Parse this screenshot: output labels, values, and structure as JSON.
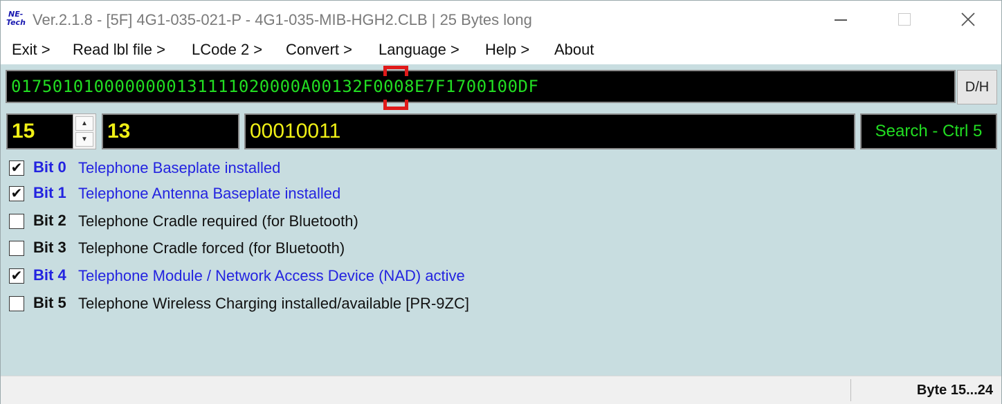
{
  "titlebar": {
    "logo_line1": "NE-",
    "logo_line2": "Tech",
    "title": "Ver.2.1.8 - [5F] 4G1-035-021-P - 4G1-035-MIB-HGH2.CLB | 25 Bytes long",
    "minimize_glyph": "—",
    "maximize_glyph": "☐",
    "close_glyph": "✕"
  },
  "menu": {
    "items": [
      "Exit >",
      "Read lbl file >",
      "LCode 2 >",
      "Convert >",
      "Language >",
      "Help >",
      "About"
    ]
  },
  "hex": {
    "value": "0175010100000000131111020000A00132F0008E7F1700100DF",
    "toggle_label": "D/H"
  },
  "fields": {
    "byte_index": "15",
    "decimal_value": "13",
    "binary_value": "00010011",
    "search_label": "Search - Ctrl 5",
    "spin_up": "▲",
    "spin_down": "▼"
  },
  "bits": [
    {
      "label": "Bit 0",
      "description": "Telephone Baseplate installed",
      "checked": true
    },
    {
      "label": "Bit 1",
      "description": "Telephone Antenna Baseplate installed",
      "checked": true
    },
    {
      "label": "Bit 2",
      "description": "Telephone Cradle required (for Bluetooth)",
      "checked": false
    },
    {
      "label": "Bit 3",
      "description": "Telephone Cradle forced (for Bluetooth)",
      "checked": false
    },
    {
      "label": "Bit 4",
      "description": "Telephone Module / Network Access Device (NAD) active",
      "checked": true
    },
    {
      "label": "Bit 5",
      "description": "Telephone Wireless Charging installed/available [PR-9ZC]",
      "checked": false
    }
  ],
  "checkmark_glyph": "✔",
  "status": {
    "byte_range": "Byte 15...24"
  },
  "colors": {
    "background": "#c8dde0",
    "hex_text": "#22dd22",
    "field_text": "#f0f016",
    "checked_text": "#2323e0",
    "cursor_marker": "#e01a1a"
  }
}
